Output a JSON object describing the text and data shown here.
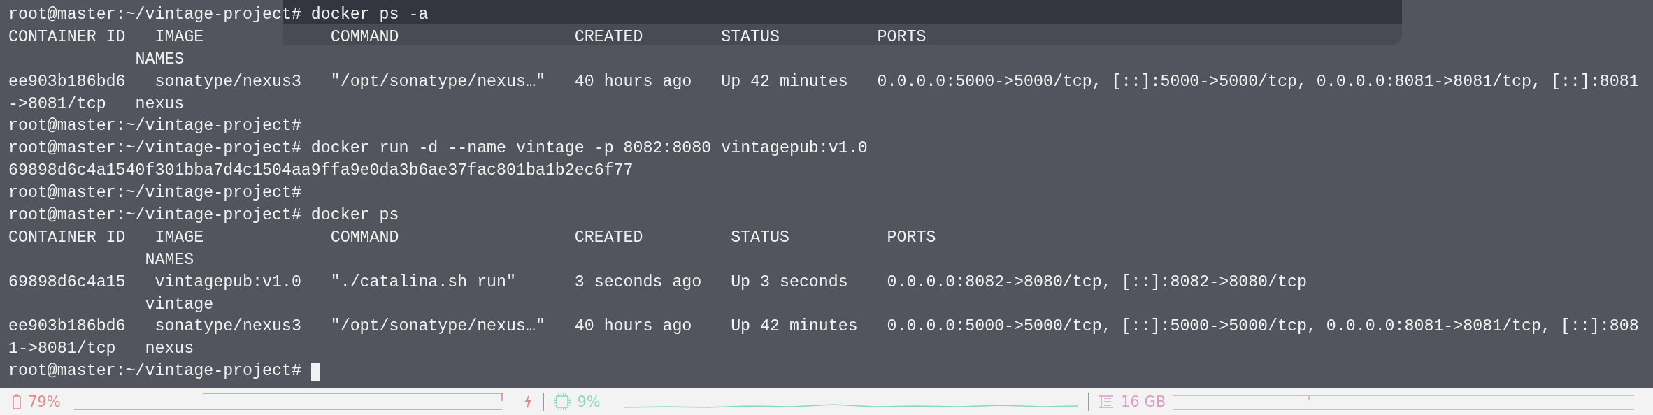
{
  "terminal": {
    "lines": [
      {
        "kind": "prompt",
        "prompt": "root@master:~/vintage-project#",
        "command": "docker ps -a"
      },
      {
        "kind": "output",
        "text": "CONTAINER ID   IMAGE             COMMAND                  CREATED        STATUS          PORTS"
      },
      {
        "kind": "output",
        "text": "             NAMES"
      },
      {
        "kind": "output",
        "text": "ee903b186bd6   sonatype/nexus3   \"/opt/sonatype/nexus…\"   40 hours ago   Up 42 minutes   0.0.0.0:5000->5000/tcp, [::]:5000->5000/tcp, 0.0.0.0:8081->8081/tcp, [::]:8081"
      },
      {
        "kind": "output",
        "text": "->8081/tcp   nexus"
      },
      {
        "kind": "prompt",
        "prompt": "root@master:~/vintage-project#"
      },
      {
        "kind": "prompt",
        "prompt": "root@master:~/vintage-project#",
        "command": "docker run -d --name vintage -p 8082:8080 vintagepub:v1.0"
      },
      {
        "kind": "output",
        "text": "69898d6c4a1540f301bba7d4c1504aa9ffa9e0da3b6ae37fac801ba1b2ec6f77"
      },
      {
        "kind": "prompt",
        "prompt": "root@master:~/vintage-project#"
      },
      {
        "kind": "prompt",
        "prompt": "root@master:~/vintage-project#",
        "command": "docker ps"
      },
      {
        "kind": "output",
        "text": "CONTAINER ID   IMAGE             COMMAND                  CREATED         STATUS          PORTS"
      },
      {
        "kind": "output",
        "text": "              NAMES"
      },
      {
        "kind": "output",
        "text": "69898d6c4a15   vintagepub:v1.0   \"./catalina.sh run\"      3 seconds ago   Up 3 seconds    0.0.0.0:8082->8080/tcp, [::]:8082->8080/tcp"
      },
      {
        "kind": "output",
        "text": "              vintage"
      },
      {
        "kind": "output",
        "text": "ee903b186bd6   sonatype/nexus3   \"/opt/sonatype/nexus…\"   40 hours ago    Up 42 minutes   0.0.0.0:5000->5000/tcp, [::]:5000->5000/tcp, 0.0.0.0:8081->8081/tcp, [::]:808"
      },
      {
        "kind": "output",
        "text": "1->8081/tcp   nexus"
      },
      {
        "kind": "prompt",
        "prompt": "root@master:~/vintage-project#",
        "cursor": true
      }
    ]
  },
  "status_bar": {
    "items": [
      {
        "kind": "battery",
        "value": "79%",
        "color": "#e08c8c"
      },
      {
        "kind": "cpu",
        "value": "9%",
        "color": "#8ed9bd"
      },
      {
        "kind": "memory",
        "value": "16 GB",
        "color": "#d9a0c8"
      }
    ]
  }
}
